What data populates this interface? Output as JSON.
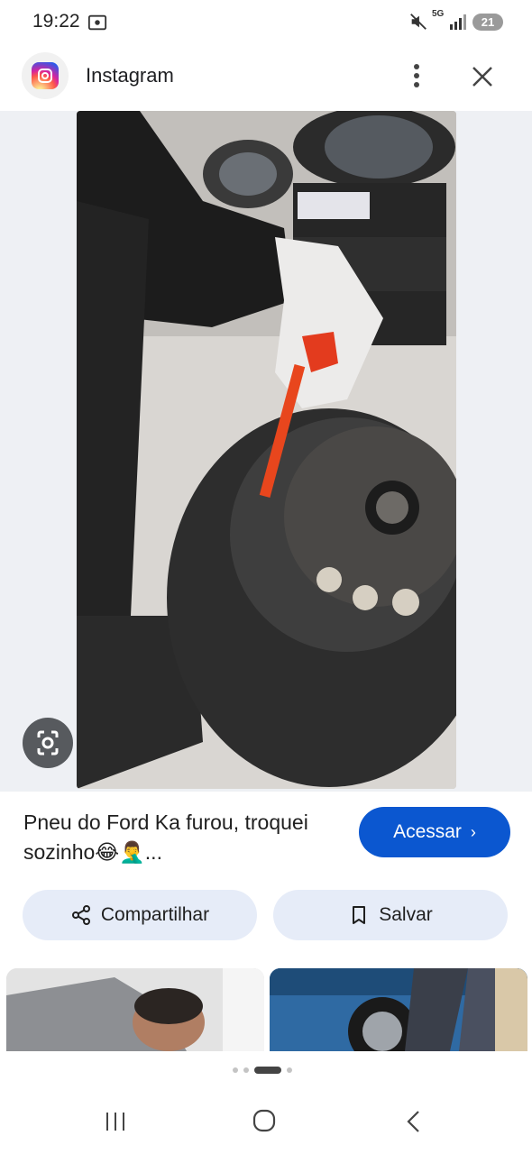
{
  "status_bar": {
    "time": "19:22",
    "network": "5G",
    "battery": "21",
    "icons": [
      "screen-record-icon",
      "mute-icon",
      "signal-icon",
      "battery-icon"
    ]
  },
  "header": {
    "title": "Instagram",
    "icons": [
      "instagram-logo-icon",
      "more-vertical-icon",
      "close-icon"
    ]
  },
  "image": {
    "alt_icon": "google-lens-icon"
  },
  "post": {
    "title": "Pneu do Ford Ka furou, troquei sozinho😂🤦‍♂️...",
    "visit_label": "Acessar",
    "visit_chevron": "›"
  },
  "actions": {
    "share_label": "Compartilhar",
    "save_label": "Salvar"
  },
  "colors": {
    "accent": "#0b57d0",
    "chip_bg": "#e6ecf8",
    "image_bg": "#eef0f4"
  }
}
